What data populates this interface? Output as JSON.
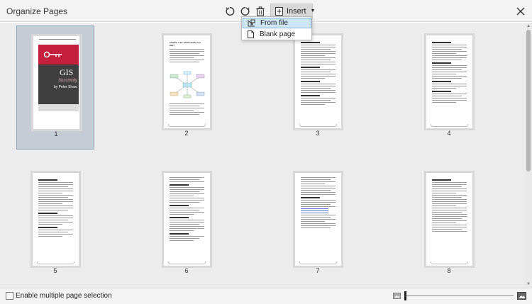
{
  "window": {
    "title": "Organize Pages"
  },
  "toolbar": {
    "rotate_left_icon": "rotate-counterclockwise-icon",
    "rotate_right_icon": "rotate-clockwise-icon",
    "delete_icon": "trash-icon",
    "insert_label": "Insert",
    "insert_icon": "add-page-icon"
  },
  "insert_menu": {
    "items": [
      {
        "label": "From file",
        "icon": "file-import-icon",
        "highlighted": true
      },
      {
        "label": "Blank page",
        "icon": "blank-page-icon",
        "highlighted": false
      }
    ]
  },
  "pages": [
    {
      "number": "1",
      "selected": true
    },
    {
      "number": "2",
      "selected": false
    },
    {
      "number": "3",
      "selected": false
    },
    {
      "number": "4",
      "selected": false
    },
    {
      "number": "5",
      "selected": false
    },
    {
      "number": "6",
      "selected": false
    },
    {
      "number": "7",
      "selected": false
    },
    {
      "number": "8",
      "selected": false
    }
  ],
  "page1_cover": {
    "title": "GIS",
    "subtitle": "Succinctly",
    "author": "by Peter Shaw"
  },
  "page2": {
    "heading": "Chapter 1 So, what exactly is a GIS?"
  },
  "footer": {
    "multi_select_label": "Enable multiple page selection",
    "multi_select_checked": false
  },
  "colors": {
    "selection": "#c4ccd5",
    "menu_highlight": "#cfe6f7",
    "cover_accent": "#c41f3c"
  }
}
